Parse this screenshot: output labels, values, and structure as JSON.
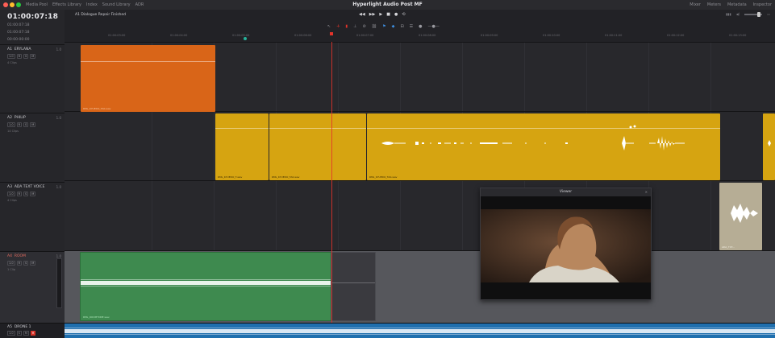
{
  "window": {
    "title": "Hyperlight Audio Post MF",
    "tabs": [
      "Media Pool",
      "Effects Library",
      "Index",
      "Sound Library",
      "ADR"
    ],
    "right_menu": [
      "Mixer",
      "Meters",
      "Metadata",
      "Inspector"
    ]
  },
  "timecode": {
    "main": "01:00:07:18",
    "rows": [
      "01:00:07:18",
      "01:00:07:18",
      "00:00:00:00"
    ]
  },
  "project": {
    "name": "A1 Dialogue Repair Finished"
  },
  "transport_icons": [
    "rewind-icon",
    "fast-forward-icon",
    "play-icon",
    "stop-icon",
    "record-icon",
    "loop-icon"
  ],
  "ruler": {
    "ticks": [
      "01:00:03:00",
      "01:00:04:00",
      "01:00:05:00",
      "01:00:06:00",
      "01:00:07:00",
      "01:00:08:00",
      "01:00:09:00",
      "01:00:10:00",
      "01:00:11:00",
      "01:00:12:00",
      "01:00:13:00"
    ]
  },
  "tracks": [
    {
      "id": "A1",
      "name": "ERYLANA",
      "count": "1.0",
      "clips": "4 Clips"
    },
    {
      "id": "A2",
      "name": "PHILIP",
      "count": "1.0",
      "clips": "14 Clips"
    },
    {
      "id": "A3",
      "name": "ADA TEXT VOICE",
      "count": "1.0",
      "clips": "4 Clips"
    },
    {
      "id": "A4",
      "name": "ROOM",
      "count": "1.0",
      "clips": "1 Clip"
    }
  ],
  "bottom_track": {
    "id": "A5",
    "name": "DRONE 1",
    "count": "1.0"
  },
  "clips": {
    "a1_clip": "RML_KYUEDO_TAK.wav",
    "a2_clip1": "RML_KYUEDO_T.wav",
    "a2_clip2": "RML_KYUEDO_TAK.wav",
    "a2_clip3": "RML_KYUEDO_TAK.wav",
    "a3_clip": "ADA_TXT...",
    "a4_clip": "RML_ROOMTONE.wav"
  },
  "viewer": {
    "title": "Viewer"
  },
  "colors": {
    "orange": "#d96518",
    "yellow": "#d6a411",
    "green": "#3e8a4f",
    "tan": "#b6ad95",
    "blue": "#1f6fae",
    "playhead": "#e4332a"
  }
}
